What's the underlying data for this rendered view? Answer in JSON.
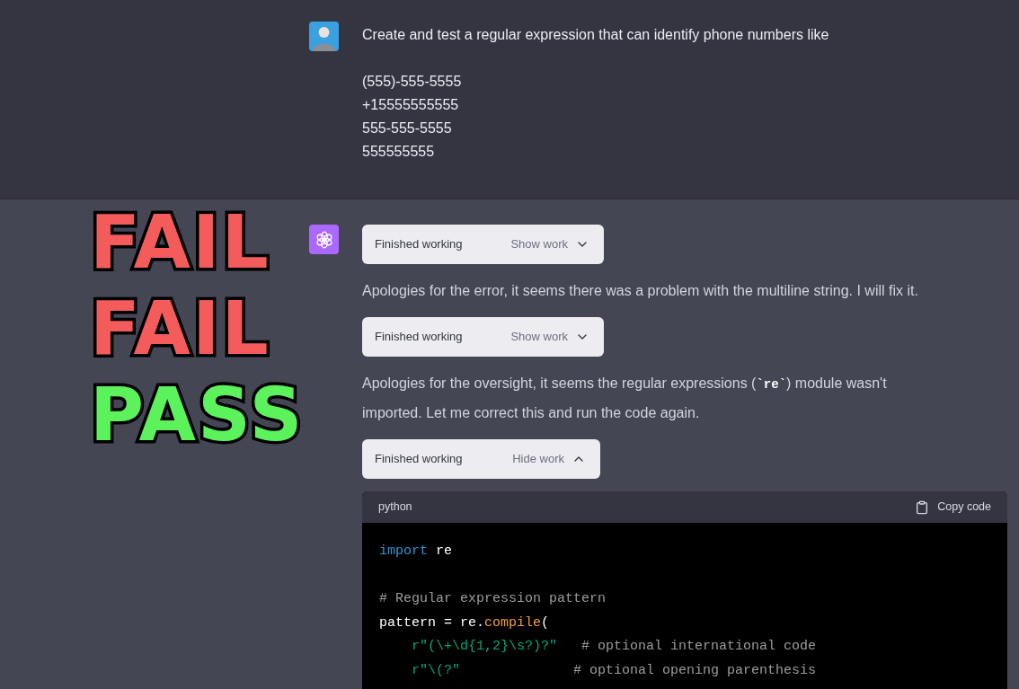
{
  "overlay": [
    {
      "text": "FAIL",
      "kind": "fail"
    },
    {
      "text": "FAIL",
      "kind": "fail"
    },
    {
      "text": "PASS",
      "kind": "pass"
    }
  ],
  "user_message": {
    "lines": [
      "Create and test a regular expression that can identify phone numbers like",
      "(555)-555-5555",
      "+15555555555",
      "555-555-5555",
      "555555555"
    ]
  },
  "assistant_message": {
    "blocks": [
      {
        "kind": "work",
        "label": "Finished working",
        "toggle": "Show work",
        "expanded": false
      },
      {
        "kind": "text",
        "parts": [
          {
            "kind": "text",
            "text": "Apologies for the error, it seems there was a problem with the multiline string. I will fix it."
          }
        ]
      },
      {
        "kind": "work",
        "label": "Finished working",
        "toggle": "Show work",
        "expanded": false
      },
      {
        "kind": "text",
        "parts": [
          {
            "kind": "text",
            "text": "Apologies for the oversight, it seems the regular expressions ("
          },
          {
            "kind": "code",
            "text": "`re`"
          },
          {
            "kind": "text",
            "text": ") module wasn't imported. Let me correct this and run the code again."
          }
        ]
      },
      {
        "kind": "work",
        "label": "Finished working",
        "toggle": "Hide work",
        "expanded": true
      },
      {
        "kind": "code",
        "language": "python",
        "copy": "Copy code",
        "lines": [
          {
            "kind": "code",
            "tokens": [
              {
                "kind": "keyword",
                "text": "import"
              },
              {
                "kind": "plain",
                "text": " re"
              }
            ]
          },
          {
            "kind": "blank"
          },
          {
            "kind": "code",
            "tokens": [
              {
                "kind": "comment",
                "text": "# Regular expression pattern"
              }
            ]
          },
          {
            "kind": "code",
            "tokens": [
              {
                "kind": "plain",
                "text": "pattern = re."
              },
              {
                "kind": "func",
                "text": "compile"
              },
              {
                "kind": "plain",
                "text": "("
              }
            ]
          },
          {
            "kind": "code",
            "tokens": [
              {
                "kind": "string",
                "text": "    r\"(\\+\\d{1,2}\\s?)?\""
              },
              {
                "kind": "comment",
                "text": "   # optional international code"
              }
            ]
          },
          {
            "kind": "code",
            "tokens": [
              {
                "kind": "string",
                "text": "    r\"\\(?\""
              },
              {
                "kind": "comment",
                "text": "              # optional opening parenthesis"
              }
            ]
          }
        ]
      }
    ]
  }
}
